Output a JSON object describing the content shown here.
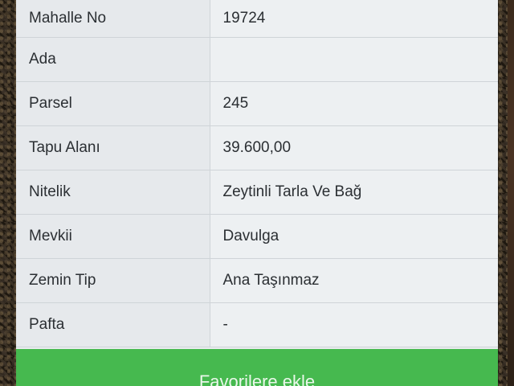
{
  "property_details": {
    "rows": [
      {
        "label": "Mahalle No",
        "value": "19724"
      },
      {
        "label": "Ada",
        "value": ""
      },
      {
        "label": "Parsel",
        "value": "245"
      },
      {
        "label": "Tapu Alanı",
        "value": "39.600,00"
      },
      {
        "label": "Nitelik",
        "value": "Zeytinli Tarla Ve Bağ"
      },
      {
        "label": "Mevkii",
        "value": "Davulga"
      },
      {
        "label": "Zemin Tip",
        "value": "Ana Taşınmaz"
      },
      {
        "label": "Pafta",
        "value": "-"
      }
    ]
  },
  "actions": {
    "favorite_label": "Favorilere ekle"
  },
  "colors": {
    "button_green": "#46b94f",
    "card_background": "#e9ecee",
    "text": "#2b2f33"
  }
}
